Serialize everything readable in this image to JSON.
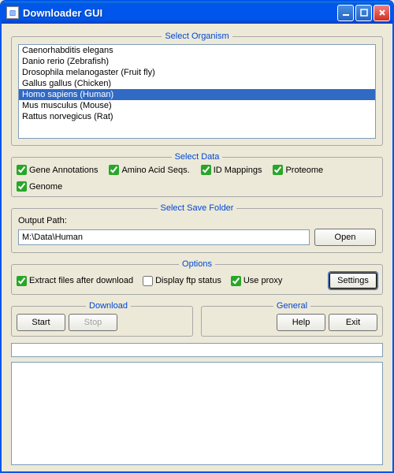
{
  "window": {
    "title": "Downloader GUI"
  },
  "organism": {
    "legend": "Select Organism",
    "items": [
      "Caenorhabditis elegans",
      "Danio rerio (Zebrafish)",
      "Drosophila melanogaster (Fruit fly)",
      "Gallus gallus (Chicken)",
      "Homo sapiens (Human)",
      "Mus musculus (Mouse)",
      "Rattus norvegicus (Rat)"
    ],
    "selected_index": 4
  },
  "data": {
    "legend": "Select Data",
    "checks": [
      {
        "label": "Gene Annotations",
        "checked": true
      },
      {
        "label": "Amino Acid Seqs.",
        "checked": true
      },
      {
        "label": "ID Mappings",
        "checked": true
      },
      {
        "label": "Proteome",
        "checked": true
      },
      {
        "label": "Genome",
        "checked": true
      }
    ]
  },
  "save": {
    "legend": "Select Save Folder",
    "label": "Output Path:",
    "path": "M:\\Data\\Human",
    "open": "Open"
  },
  "options": {
    "legend": "Options",
    "extract": {
      "label": "Extract files after download",
      "checked": true
    },
    "ftp": {
      "label": "Display ftp status",
      "checked": false
    },
    "proxy": {
      "label": "Use proxy",
      "checked": true
    },
    "settings": "Settings"
  },
  "download": {
    "legend": "Download",
    "start": "Start",
    "stop": "Stop"
  },
  "general": {
    "legend": "General",
    "help": "Help",
    "exit": "Exit"
  }
}
